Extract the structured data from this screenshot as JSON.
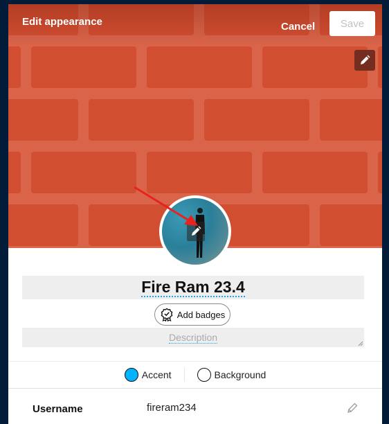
{
  "header": {
    "title": "Edit appearance",
    "cancel_label": "Cancel",
    "save_label": "Save"
  },
  "cover": {
    "edit_icon": "pencil-icon",
    "brick_color": "#d24e31",
    "mortar_color": "#d9644a"
  },
  "avatar": {
    "edit_icon": "pencil-icon",
    "annotation": "red-arrow"
  },
  "profile": {
    "display_name": "Fire Ram 23.4",
    "add_badges_label": "Add badges",
    "badge_icon": "badge-award-icon",
    "description_placeholder": "Description",
    "description_value": ""
  },
  "colors": {
    "options": [
      {
        "label": "Accent",
        "swatch": "#00b2ff"
      },
      {
        "label": "Background",
        "swatch": "#ffffff"
      }
    ]
  },
  "fields": {
    "username_label": "Username",
    "username_value": "fireram234",
    "edit_icon": "pencil-icon"
  }
}
